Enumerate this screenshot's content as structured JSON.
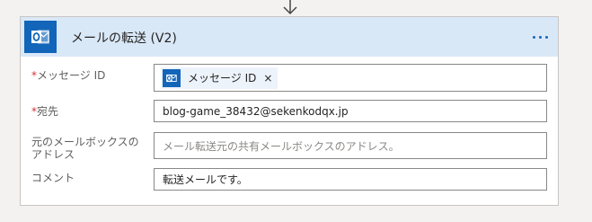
{
  "action": {
    "title": "メールの転送 (V2)",
    "icon": "outlook-icon",
    "more_icon": "more-options-icon"
  },
  "fields": {
    "message_id": {
      "label": "メッセージ ID",
      "required": "*",
      "token_label": "メッセージ ID",
      "token_remove": "×"
    },
    "to": {
      "label": "宛先",
      "required": "*",
      "value": "blog-game_38432@sekenkodqx.jp"
    },
    "shared_mailbox": {
      "label": "元のメールボックスのアドレス",
      "placeholder": "メール転送元の共有メールボックスのアドレス。"
    },
    "comment": {
      "label": "コメント",
      "value": "転送メールです。"
    }
  },
  "colors": {
    "header_background": "#d9e8f7",
    "icon_background": "#1265b9",
    "required_marker": "#d13438",
    "accent": "#1565c0"
  }
}
